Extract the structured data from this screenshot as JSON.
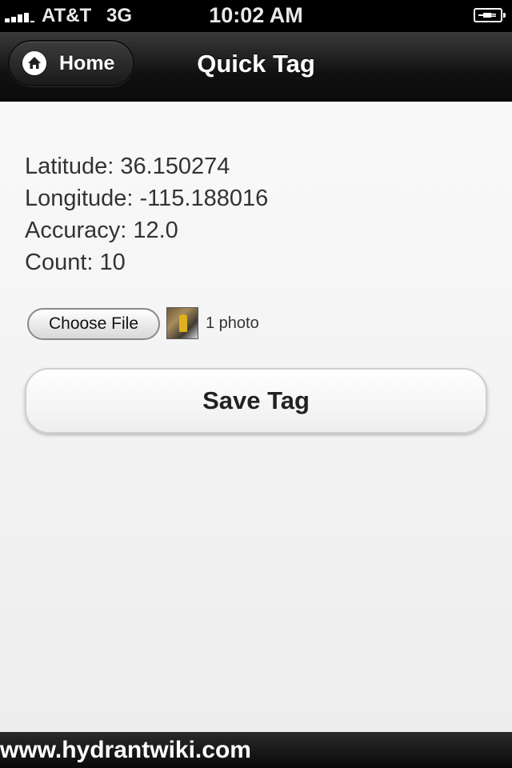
{
  "status_bar": {
    "carrier": "AT&T",
    "network": "3G",
    "time": "10:02 AM",
    "signal_bars": 4,
    "battery_state": "charging"
  },
  "nav": {
    "home_label": "Home",
    "title": "Quick Tag"
  },
  "location": {
    "latitude": "Latitude: 36.150274",
    "longitude": "Longitude: -115.188016",
    "accuracy": "Accuracy: 12.0",
    "count": "Count: 10"
  },
  "file_input": {
    "button_label": "Choose File",
    "selection": "1 photo"
  },
  "actions": {
    "save_label": "Save Tag"
  },
  "footer": {
    "text": "www.hydrantwiki.com"
  },
  "icons": {
    "home": "home-icon",
    "battery": "battery-icon",
    "signal": "signal-icon"
  }
}
